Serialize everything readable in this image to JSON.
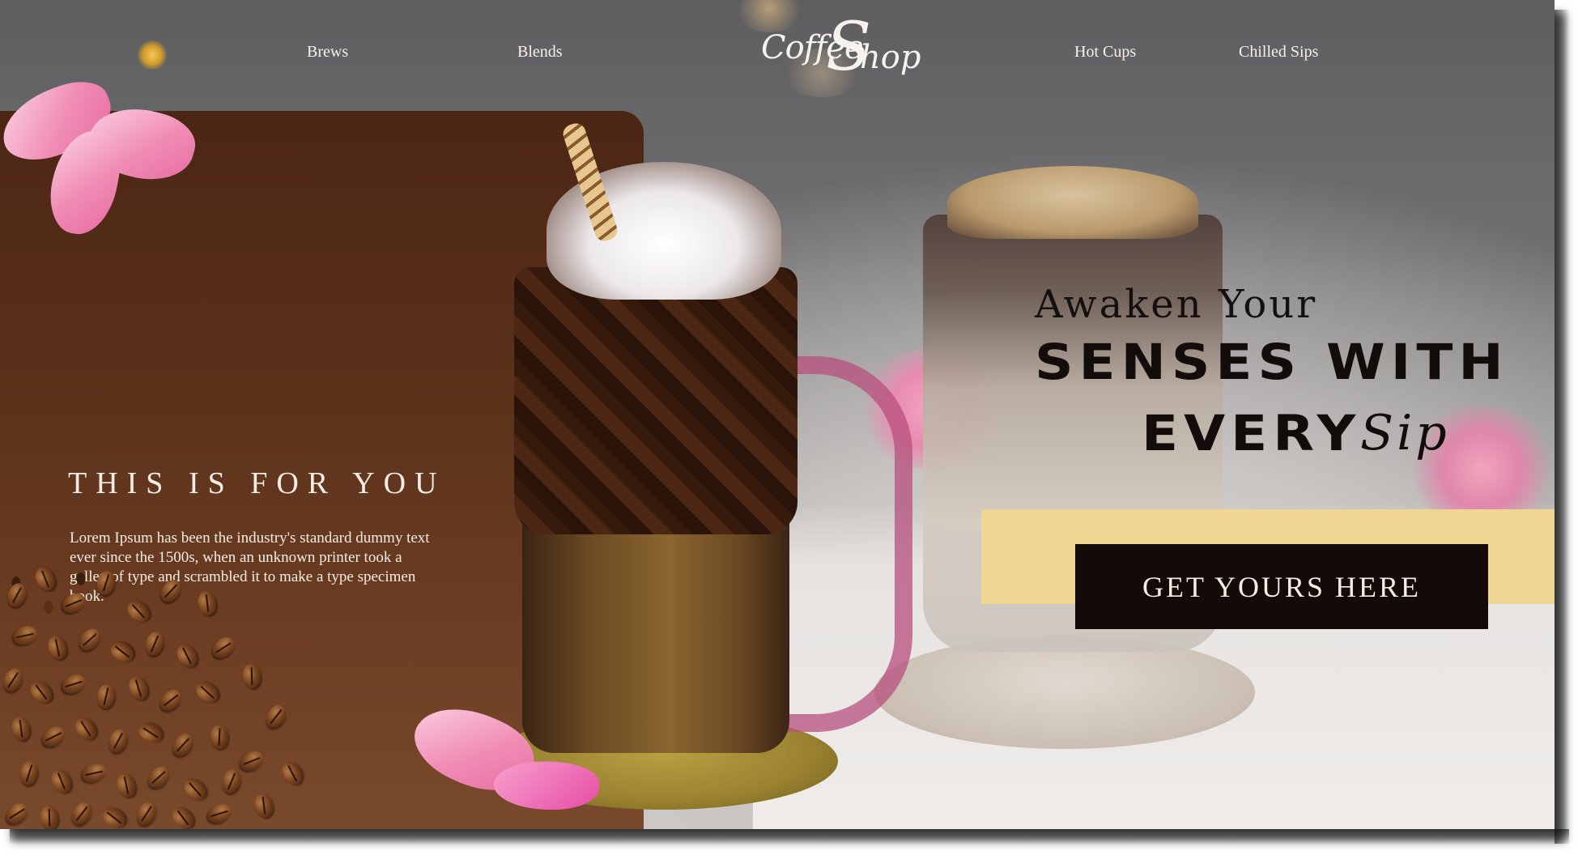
{
  "brand": {
    "logo_part1": "Coffee",
    "logo_part2": "S",
    "logo_part3": "hop"
  },
  "nav": {
    "left": [
      {
        "label": "Brews"
      },
      {
        "label": "Blends"
      }
    ],
    "right": [
      {
        "label": "Hot Cups"
      },
      {
        "label": "Chilled Sips"
      }
    ]
  },
  "card": {
    "title": "THIS IS FOR YOU",
    "text": "Lorem Ipsum has been the industry's standard dummy text ever since the 1500s, when an unknown printer took a galley of type and scrambled it to make a type specimen book."
  },
  "hero": {
    "line1": "Awaken Your",
    "line2": "SENSES WITH",
    "line3": "EVERY",
    "line3_script": "Sip"
  },
  "cta": {
    "label": "GET YOURS HERE"
  },
  "colors": {
    "card_brown": "#5c321b",
    "cta_band": "#f0d693",
    "cta_button": "#140b08",
    "text_light": "#f4ede4"
  }
}
